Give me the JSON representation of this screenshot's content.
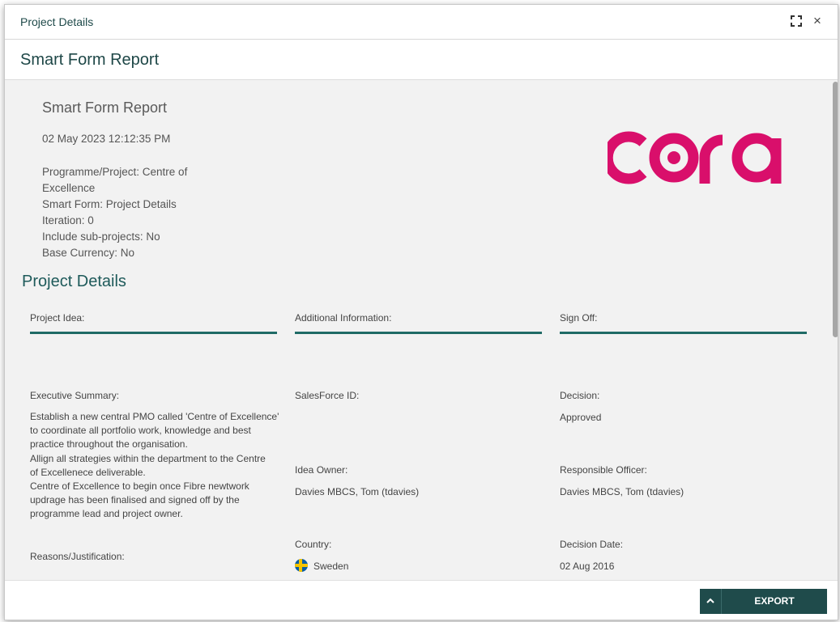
{
  "modal": {
    "title": "Project Details",
    "close_glyph": "×"
  },
  "report_bar": {
    "title": "Smart Form Report"
  },
  "report": {
    "title": "Smart Form Report",
    "date": "02 May 2023 12:12:35 PM",
    "meta": [
      "Programme/Project: Centre of Excellence",
      "Smart Form: Project Details",
      "Iteration: 0",
      "Include sub-projects: No",
      "Base Currency: No"
    ],
    "logo_text": "cora",
    "logo_color": "#d90f6b"
  },
  "section": {
    "title": "Project Details",
    "columns": [
      "Project Idea:",
      "Additional Information:",
      "Sign Off:"
    ],
    "fields": {
      "executive_summary_label": "Executive Summary:",
      "executive_summary_value": [
        "Establish a new central PMO called 'Centre of Excellence'",
        "to coordinate all portfolio work, knowledge and best",
        "practice throughout the organisation.",
        "Allign all strategies within the department  to the Centre",
        "of Excellenece deliverable.",
        "Centre of Excellence to begin once Fibre newtwork",
        "updrage has been finalised and signed off by the",
        "programme lead and project owner."
      ],
      "reasons_label": "Reasons/Justification:",
      "salesforce_label": "SalesForce ID:",
      "idea_owner_label": "Idea Owner:",
      "idea_owner_value": "Davies MBCS, Tom (tdavies)",
      "country_label": "Country:",
      "country_value": "Sweden",
      "decision_label": "Decision:",
      "decision_value": "Approved",
      "responsible_label": "Responsible Officer:",
      "responsible_value": "Davies MBCS, Tom (tdavies)",
      "decision_date_label": "Decision Date:",
      "decision_date_value": "02 Aug 2016"
    }
  },
  "footer": {
    "export_label": "EXPORT",
    "accent": "#1f4b4b"
  },
  "icons": {
    "expand": "expand-icon",
    "close": "close-icon",
    "chevron": "chevron-up-icon",
    "flag": "sweden-flag-icon"
  }
}
